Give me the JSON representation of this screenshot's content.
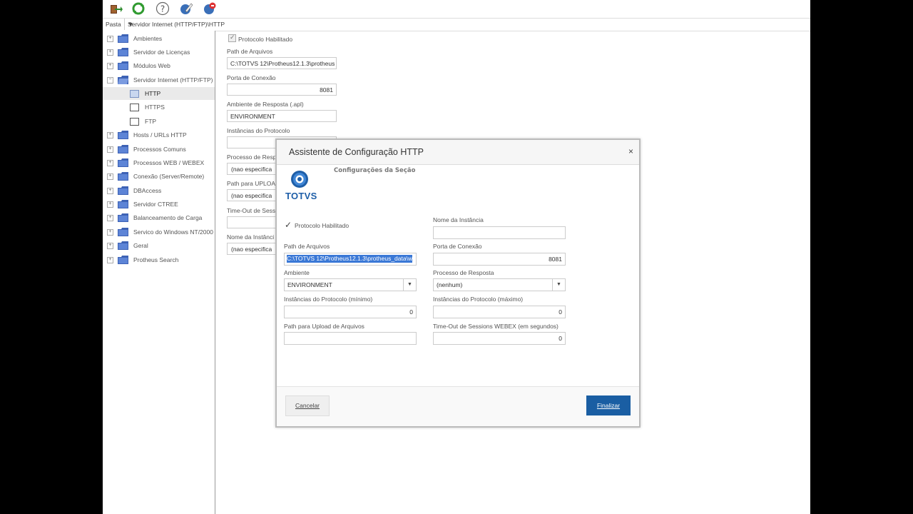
{
  "toolbar": {
    "icons": [
      "exit-icon",
      "refresh-icon",
      "help-icon",
      "edit-icon",
      "disconnect-icon"
    ]
  },
  "pathbar": {
    "label": "Pasta",
    "value": "Servidor Internet (HTTP/FTP)\\HTTP"
  },
  "tree": {
    "items": [
      "Ambientes",
      "Servidor de Licenças",
      "Módulos Web",
      "Servidor Internet (HTTP/FTP)",
      "HTTP",
      "HTTPS",
      "FTP",
      "Hosts / URLs HTTP",
      "Processos Comuns",
      "Processos WEB / WEBEX",
      "Conexão (Server/Remote)",
      "DBAccess",
      "Servidor CTREE",
      "Balanceamento de Carga",
      "Servico do Windows NT/2000",
      "Geral",
      "Protheus Search"
    ]
  },
  "bg_form": {
    "protocolo_label": "Protocolo Habilitado",
    "path_label": "Path de Arquivos",
    "path_value": "C:\\TOTVS 12\\Protheus12.1.3\\protheus_",
    "porta_label": "Porta de Conexão",
    "porta_value": "8081",
    "ambiente_label": "Ambiente de Resposta (.apl)",
    "ambiente_value": "ENVIRONMENT",
    "instancias_label": "Instâncias do Protocolo",
    "processo_label": "Processo de Resp",
    "processo_value": "(nao especifica",
    "upload_label": "Path para UPLOA",
    "upload_value": "(nao especifica",
    "timeout_label": "Time-Out de Sessi",
    "nome_label": "Nome da Instânci",
    "nome_value": "(nao especifica"
  },
  "dialog": {
    "title": "Assistente de Configuração  HTTP",
    "close": "×",
    "logo_text": "TOTVS",
    "section": "Configurações da Seção",
    "protocolo_label": "Protocolo Habilitado",
    "nome_instancia_label": "Nome da Instância",
    "nome_instancia_value": "",
    "path_label": "Path de Arquivos",
    "path_value": "C:\\TOTVS 12\\Protheus12.1.3\\protheus_data\\we",
    "porta_label": "Porta de Conexão",
    "porta_value": "8081",
    "ambiente_label": "Ambiente",
    "ambiente_value": "ENVIRONMENT",
    "processo_label": "Processo de Resposta",
    "processo_value": "(nenhum)",
    "inst_min_label": "Instâncias do Protocolo (mínimo)",
    "inst_min_value": "0",
    "inst_max_label": "Instâncias do Protocolo (máximo)",
    "inst_max_value": "0",
    "upload_label": "Path para Upload de Arquivos",
    "upload_value": "",
    "timeout_label": "Time-Out de Sessions WEBEX (em segundos)",
    "timeout_value": "0",
    "cancel_label": "Cancelar",
    "finish_label": "Finalizar"
  }
}
